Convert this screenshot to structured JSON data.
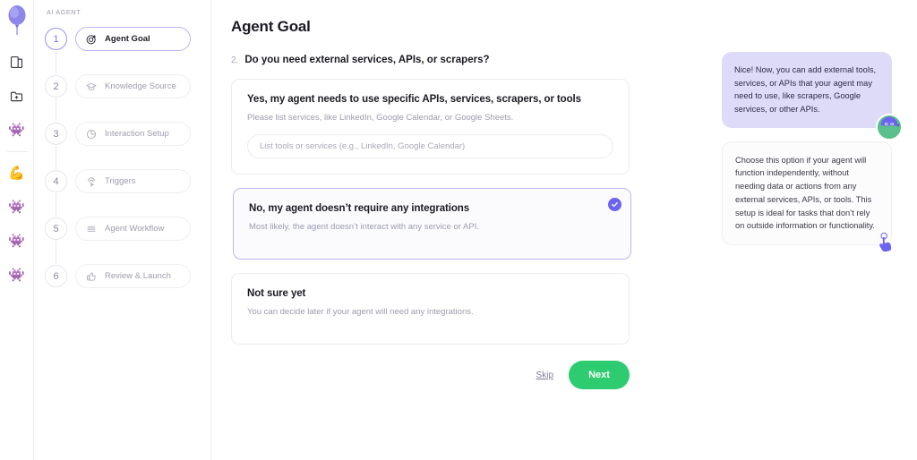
{
  "rail": {
    "logo_name": "balloon-logo",
    "items": [
      {
        "name": "book-page-icon"
      },
      {
        "name": "folder-add-icon"
      },
      {
        "name": "alien-icon-1"
      },
      {
        "name": "muscle-arm-icon"
      },
      {
        "name": "alien-icon-2"
      },
      {
        "name": "alien-icon-3"
      },
      {
        "name": "alien-icon-4"
      }
    ]
  },
  "stepper": {
    "title": "AI AGENT",
    "steps": [
      {
        "num": "1",
        "label": "Agent Goal",
        "icon": "target-icon",
        "active": true
      },
      {
        "num": "2",
        "label": "Knowledge Source",
        "icon": "graduation-cap-icon",
        "active": false
      },
      {
        "num": "3",
        "label": "Interaction Setup",
        "icon": "clock-pie-icon",
        "active": false
      },
      {
        "num": "4",
        "label": "Triggers",
        "icon": "click-trigger-icon",
        "active": false
      },
      {
        "num": "5",
        "label": "Agent Workflow",
        "icon": "stack-list-icon",
        "active": false
      },
      {
        "num": "6",
        "label": "Review & Launch",
        "icon": "thumbs-up-icon",
        "active": false
      }
    ]
  },
  "main": {
    "page_title": "Agent Goal",
    "question_number": "2.",
    "question": "Do you need external services, APIs, or scrapers?",
    "options": [
      {
        "title": "Yes, my agent needs to use specific APIs, services, scrapers, or tools",
        "subtitle": "Please list services, like LinkedIn, Google Calendar, or Google Sheets.",
        "input_placeholder": "List tools or services (e.g., LinkedIn, Google Calendar)",
        "input_value": "",
        "selected": false
      },
      {
        "title": "No, my agent doesn’t require any integrations",
        "subtitle": "Most likely, the agent doesn’t interact with any service or API.",
        "selected": true
      },
      {
        "title": "Not sure yet",
        "subtitle": "You can decide later if your agent will need any integrations.",
        "selected": false
      }
    ],
    "skip_label": "Skip",
    "next_label": "Next"
  },
  "chat": {
    "assistant_message": "Nice! Now, you can add external tools, services, or APIs that your agent may need to use, like scrapers, Google services, or other APIs.",
    "info_message": "Choose this option if your agent will function independently, without needing data or actions from any external services, APIs, or tools. This setup is ideal for tasks that don’t rely on outside information or functionality.",
    "avatar_name": "ninja-avatar",
    "cursor_name": "pointer-hand-icon"
  },
  "colors": {
    "accent_purple": "#6c63f0",
    "bubble_lavender": "#dedbf8",
    "next_green": "#2ecc71",
    "text_dark": "#1b1b24",
    "text_muted": "#9c9cad"
  }
}
